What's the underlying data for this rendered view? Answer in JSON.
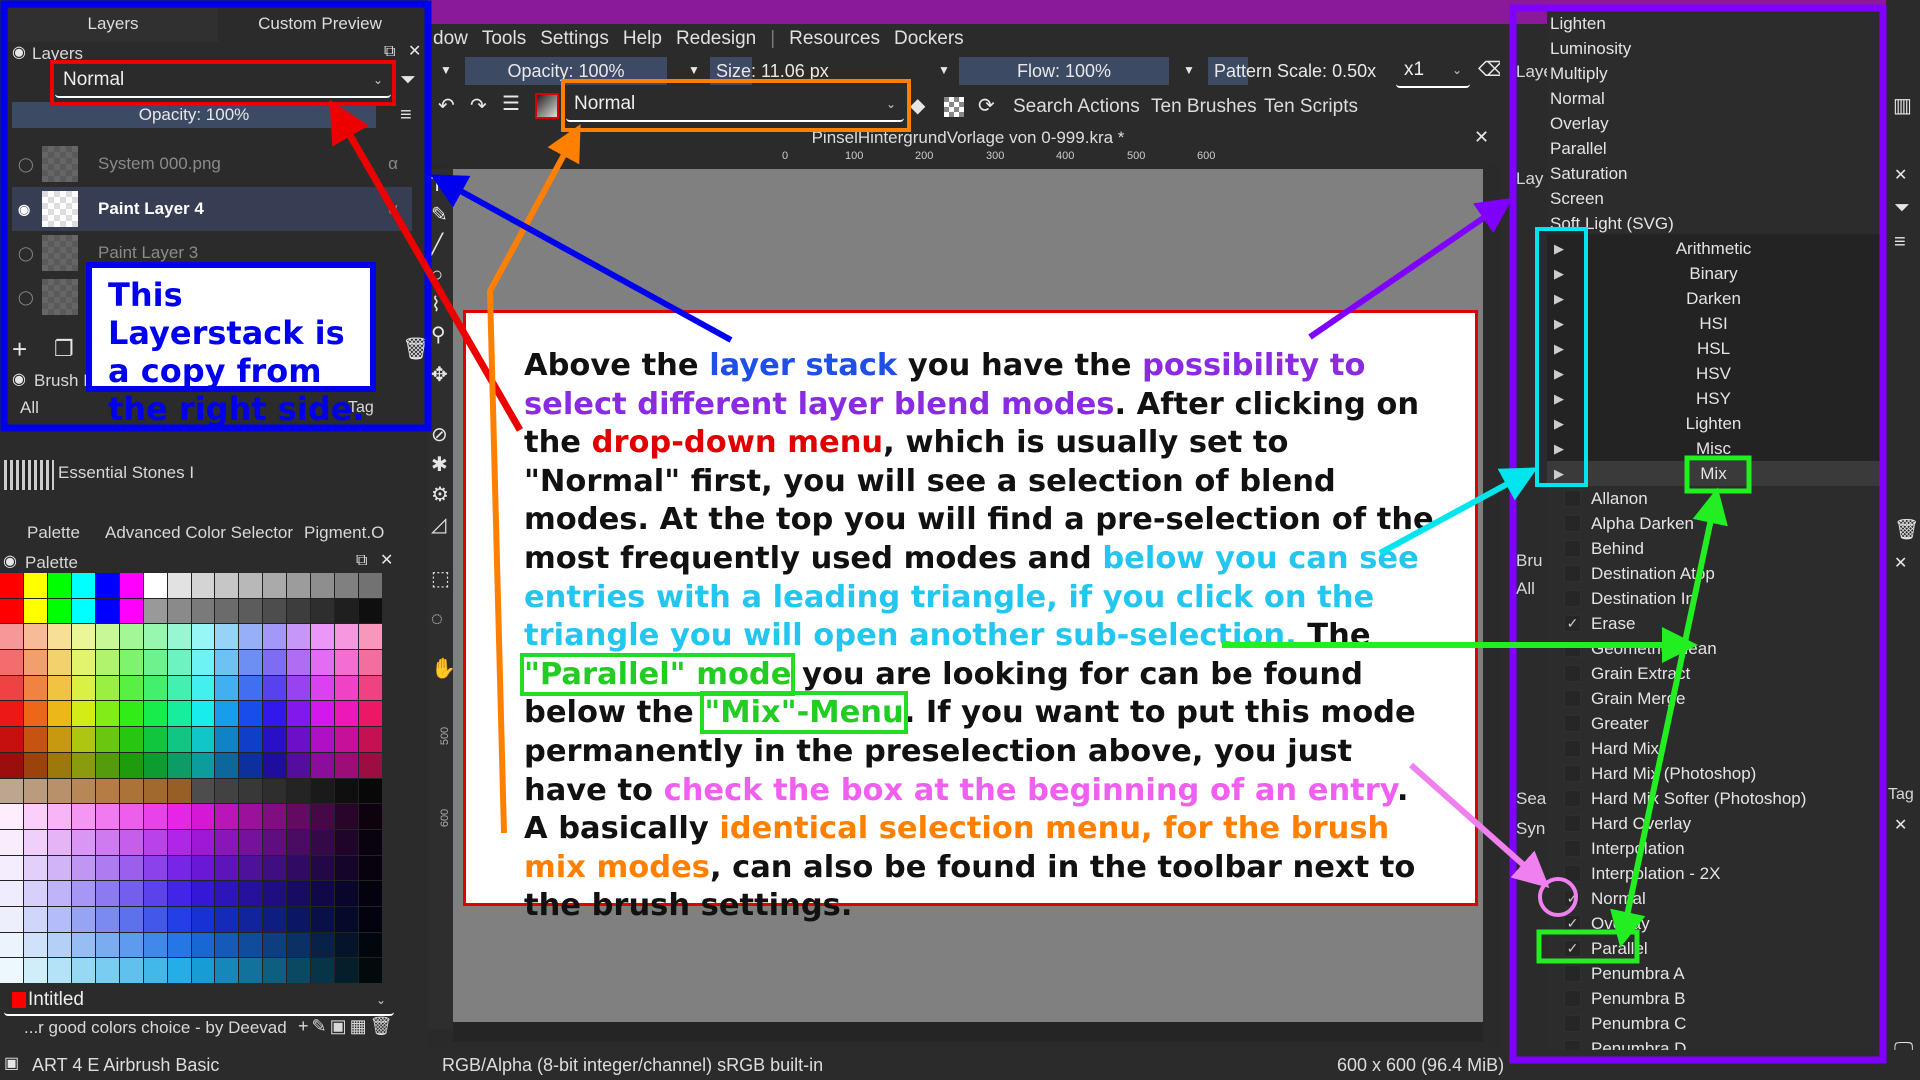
{
  "menubar": {
    "items": [
      "dow",
      "Tools",
      "Settings",
      "Help",
      "Redesign",
      "|",
      "Resources",
      "Dockers"
    ]
  },
  "toolbar": {
    "opacity": "Opacity: 100%",
    "size": "Size: 11.06 px",
    "flow": "Flow: 100%",
    "pattern_scale": "Pattern Scale: 0.50x",
    "multiplier": "x1",
    "blend_mode": "Normal",
    "search_actions": "Search Actions",
    "ten_brushes": "Ten Brushes",
    "ten_scripts": "Ten Scripts"
  },
  "document": {
    "title": "PinselHintergrundVorlage von 0-999.kra *",
    "ruler_ticks": [
      "0",
      "100",
      "200",
      "300",
      "400",
      "500",
      "600"
    ],
    "vruler_ticks": [
      "500",
      "600"
    ]
  },
  "left_dock": {
    "tabs": [
      "Layers",
      "Custom Preview"
    ],
    "layers_title": "Layers",
    "blend_mode": "Normal",
    "opacity": "Opacity:  100%",
    "layers": [
      {
        "name": "System 000.png",
        "visible": false
      },
      {
        "name": "Paint Layer 4",
        "visible": true,
        "active": true
      },
      {
        "name": "Paint Layer 3",
        "visible": false
      },
      {
        "name": "",
        "visible": false
      }
    ],
    "brush_title": "Brush I",
    "brush_filter": "All",
    "tag_label": "Tag",
    "resource_item": "Essential Stones I",
    "palette_tabs": [
      "Palette",
      "Advanced Color Selector",
      "Pigment.O"
    ],
    "palette_title": "Palette",
    "palette_first_row": [
      "#ff0000",
      "#ffff00",
      "#00ff00",
      "#00ffff",
      "#0000ff",
      "#ff00ff",
      "#ffffff",
      "#e2e2e2",
      "#d4d4d4",
      "#c6c6c6",
      "#b8b8b8",
      "#aaaaaa",
      "#9c9c9c",
      "#8e8e8e",
      "#808080",
      "#727272"
    ],
    "palette_color_label": "Intitled",
    "palette_name": "...r good colors choice - by Deevad"
  },
  "callout_left": "This Layerstack is a copy from the right side.",
  "explanation": {
    "segments": [
      {
        "text": "Above the ",
        "color": "#111111"
      },
      {
        "text": "layer stack",
        "color": "#1f4fe6"
      },
      {
        "text": " you have the ",
        "color": "#111111"
      },
      {
        "text": "possibility to select different layer blend modes",
        "color": "#8a2be2"
      },
      {
        "text": ". After clicking on the ",
        "color": "#111111"
      },
      {
        "text": "drop-down menu",
        "color": "#e00000"
      },
      {
        "text": ", which is usually set to \"Normal\" first, you will see a selection of blend modes. At the top you will find a pre-selection of the most frequently used modes and ",
        "color": "#111111"
      },
      {
        "text": "below you can see entries with a leading triangle, if you click on the triangle you will open another sub-selection.",
        "color": "#22c6ee"
      },
      {
        "text": " The ",
        "color": "#111111"
      },
      {
        "text": "\"Parallel\" mode",
        "color": "#22cc22"
      },
      {
        "text": " you are looking for can be found below the ",
        "color": "#111111"
      },
      {
        "text": "\"Mix\"-Menu",
        "color": "#22cc22"
      },
      {
        "text": ". If you want to put this mode permanently in the preselection above, you just have to ",
        "color": "#111111"
      },
      {
        "text": "check the box at the beginning of an entry",
        "color": "#f060f0"
      },
      {
        "text": ". A basically ",
        "color": "#111111"
      },
      {
        "text": "identical selection menu, for the brush mix modes",
        "color": "#ff8000"
      },
      {
        "text": ", can also be found in the toolbar next to the brush settings.",
        "color": "#111111"
      }
    ]
  },
  "blend_menu": {
    "favorites": [
      "Lighten",
      "Luminosity",
      "Multiply",
      "Normal",
      "Overlay",
      "Parallel",
      "Saturation",
      "Screen",
      "Soft Light (SVG)"
    ],
    "groups": [
      "Arithmetic",
      "Binary",
      "Darken",
      "HSI",
      "HSL",
      "HSV",
      "HSY",
      "Lighten",
      "Misc",
      "Mix"
    ],
    "open_group": "Mix",
    "mix_items": [
      {
        "label": "Allanon",
        "checked": false
      },
      {
        "label": "Alpha Darken",
        "checked": false
      },
      {
        "label": "Behind",
        "checked": false
      },
      {
        "label": "Destination Atop",
        "checked": false
      },
      {
        "label": "Destination In",
        "checked": false
      },
      {
        "label": "Erase",
        "checked": true
      },
      {
        "label": "Geometric Mean",
        "checked": false
      },
      {
        "label": "Grain Extract",
        "checked": false
      },
      {
        "label": "Grain Merge",
        "checked": false
      },
      {
        "label": "Greater",
        "checked": false
      },
      {
        "label": "Hard Mix",
        "checked": false
      },
      {
        "label": "Hard Mix (Photoshop)",
        "checked": false
      },
      {
        "label": "Hard Mix Softer (Photoshop)",
        "checked": false
      },
      {
        "label": "Hard Overlay",
        "checked": false
      },
      {
        "label": "Interpolation",
        "checked": false
      },
      {
        "label": "Interpolation - 2X",
        "checked": false
      },
      {
        "label": "Normal",
        "checked": true
      },
      {
        "label": "Overlay",
        "checked": true
      },
      {
        "label": "Parallel",
        "checked": true
      },
      {
        "label": "Penumbra A",
        "checked": false
      },
      {
        "label": "Penumbra B",
        "checked": false
      },
      {
        "label": "Penumbra C",
        "checked": false
      },
      {
        "label": "Penumbra D",
        "checked": false
      }
    ]
  },
  "right_dock_fragments": [
    "Laye",
    "Lay",
    "Bru",
    "All",
    "Searc",
    "Syn",
    "Tag"
  ],
  "status": {
    "brush": "ART 4 E Airbrush Basic",
    "color_model": "RGB/Alpha (8-bit integer/channel)  sRGB built-in",
    "image_size": "600 x 600 (96.4 MiB)"
  },
  "annotation_colors": {
    "left_dock_frame": "#0000ee",
    "blend_dropdown": "#ee0000",
    "brush_dropdown": "#ff8000",
    "menu_frame": "#8000ff",
    "triangles": "#00e5ee",
    "mix_parallel": "#22ee22",
    "checkbox": "#f080f0"
  },
  "icons": [
    "lock-icon",
    "float-icon",
    "close-icon",
    "filter-icon",
    "hamburger-icon",
    "eye-icon",
    "alpha-lock-icon",
    "add-icon",
    "duplicate-icon",
    "trash-icon",
    "undo-icon",
    "redo-icon",
    "reload-icon",
    "eraser-icon",
    "clear-icon",
    "triangle-right-icon",
    "checkmark-icon"
  ]
}
